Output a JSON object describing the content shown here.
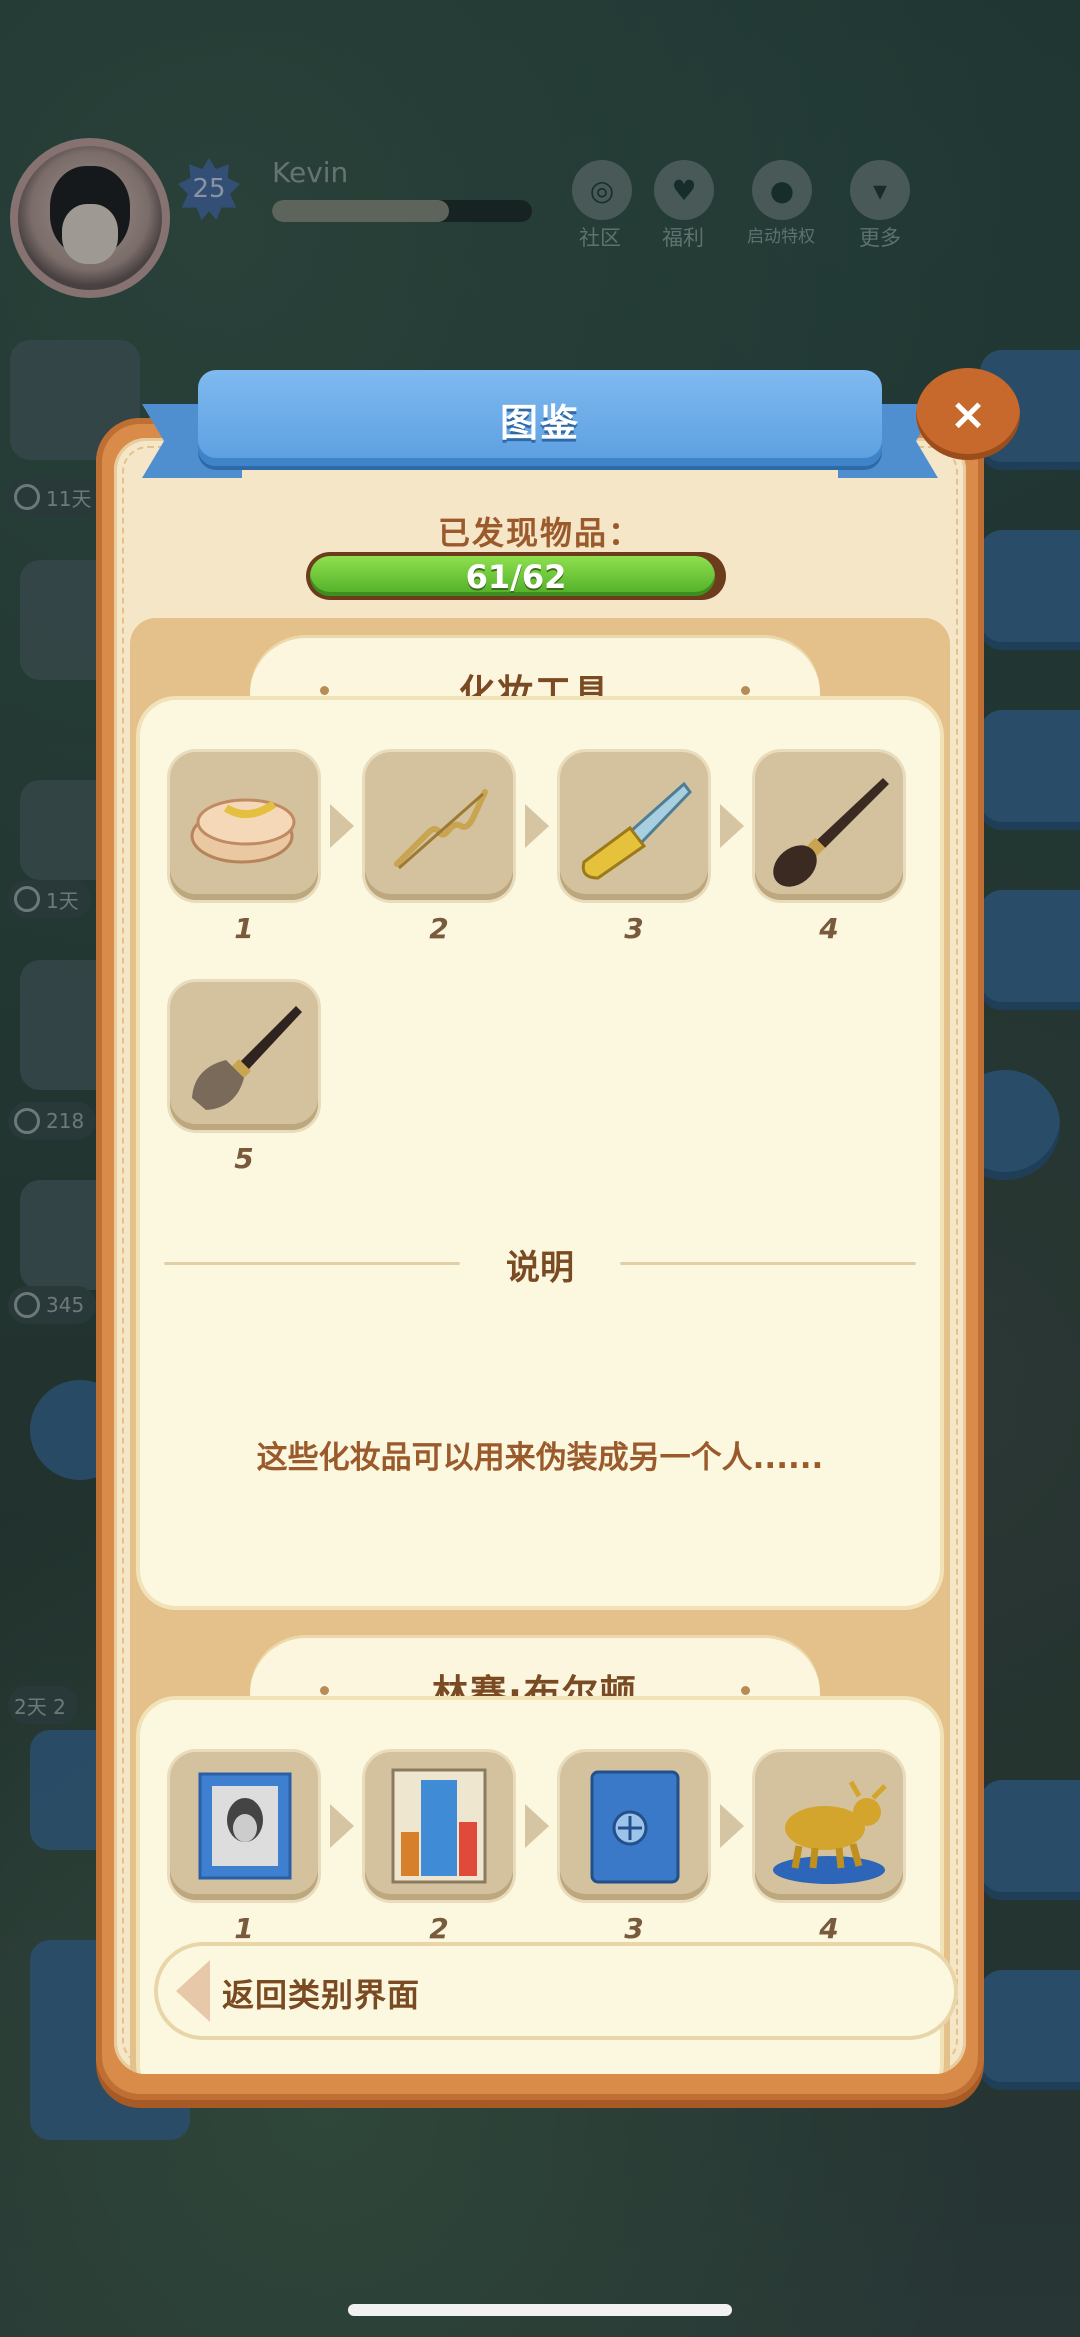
{
  "profile": {
    "level": "25",
    "username": "Kevin",
    "xp_progress": 0.68
  },
  "top_menu": [
    {
      "label": "社区",
      "icon": "community-icon"
    },
    {
      "label": "福利",
      "icon": "gift-icon"
    },
    {
      "label": "启动特权",
      "icon": "wechat-icon"
    },
    {
      "label": "更多",
      "icon": "more-icon"
    }
  ],
  "side_timers": [
    "11天",
    "1天",
    "218",
    "345",
    "2天 2"
  ],
  "dialog": {
    "title": "图鉴",
    "found_label": "已发现物品：",
    "found_count": "61/62",
    "found_fraction": 0.984,
    "close": "×"
  },
  "sections": [
    {
      "title": "化妆工具",
      "items": [
        {
          "num": "1",
          "icon": "powder-puff-icon"
        },
        {
          "num": "2",
          "icon": "hairpin-icon"
        },
        {
          "num": "3",
          "icon": "nail-file-icon"
        },
        {
          "num": "4",
          "icon": "makeup-brush-icon"
        },
        {
          "num": "5",
          "icon": "blush-brush-icon"
        }
      ],
      "desc_title": "说明",
      "desc_text": "这些化妆品可以用来伪装成另一个人......"
    },
    {
      "title": "林赛·布尔顿",
      "items": [
        {
          "num": "1",
          "icon": "photo-frame-icon"
        },
        {
          "num": "2",
          "icon": "building-picture-icon"
        },
        {
          "num": "3",
          "icon": "safe-icon"
        },
        {
          "num": "4",
          "icon": "golden-bull-icon"
        }
      ]
    }
  ],
  "back_button": {
    "label": "返回类别界面"
  },
  "colors": {
    "ribbon": "#5b9ee0",
    "progress": "#4fae27",
    "frame": "#d98b4a",
    "text_brown": "#7a4a22"
  }
}
